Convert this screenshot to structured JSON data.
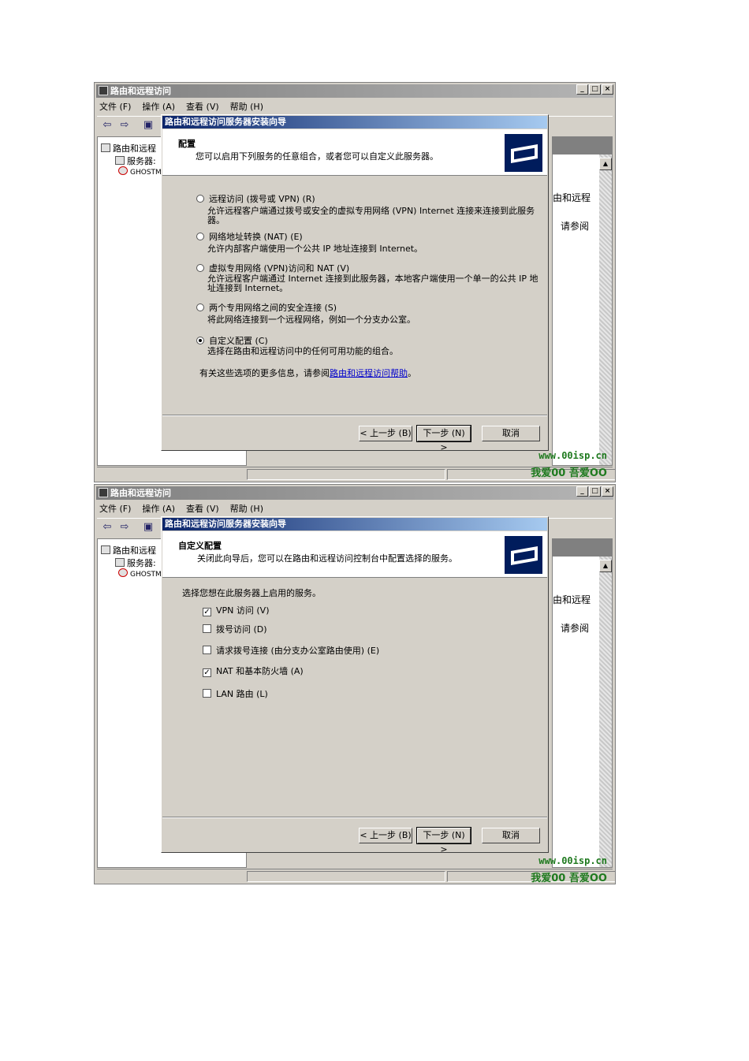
{
  "panels": [
    {
      "window_title": "路由和远程访问",
      "menu": [
        "文件 (F)",
        "操作 (A)",
        "查看 (V)",
        "帮助 (H)"
      ],
      "tree": [
        "路由和远程",
        "服务器:",
        "GHOSTM/"
      ],
      "right_text": [
        "由和远程",
        "请参阅"
      ],
      "watermark_url": "www.00isp.cn",
      "watermark_text": "我爱00 吾爱OO",
      "wizard": {
        "title": "路由和远程访问服务器安装向导",
        "heading": "配置",
        "subheading": "您可以启用下列服务的任意组合，或者您可以自定义此服务器。",
        "options": [
          {
            "label": "远程访问 (拨号或 VPN) (R)",
            "desc": "允许远程客户端通过拨号或安全的虚拟专用网络 (VPN) Internet 连接来连接到此服务器。",
            "selected": false
          },
          {
            "label": "网络地址转换 (NAT) (E)",
            "desc": "允许内部客户端使用一个公共 IP 地址连接到 Internet。",
            "selected": false
          },
          {
            "label": "虚拟专用网络 (VPN)访问和 NAT (V)",
            "desc": "允许远程客户端通过 Internet 连接到此服务器，本地客户端使用一个单一的公共 IP 地址连接到 Internet。",
            "selected": false
          },
          {
            "label": "两个专用网络之间的安全连接 (S)",
            "desc": "将此网络连接到一个远程网络，例如一个分支办公室。",
            "selected": false
          },
          {
            "label": "自定义配置 (C)",
            "desc": "选择在路由和远程访问中的任何可用功能的组合。",
            "selected": true
          }
        ],
        "help_prefix": "有关这些选项的更多信息，请参阅",
        "help_link": "路由和远程访问帮助",
        "help_suffix": "。",
        "back": "< 上一步 (B)",
        "next": "下一步 (N) >",
        "cancel": "取消"
      }
    },
    {
      "window_title": "路由和远程访问",
      "menu": [
        "文件 (F)",
        "操作 (A)",
        "查看 (V)",
        "帮助 (H)"
      ],
      "tree": [
        "路由和远程",
        "服务器:",
        "GHOSTM/"
      ],
      "right_text": [
        "由和远程",
        "请参阅"
      ],
      "watermark_url": "www.00isp.cn",
      "watermark_text": "我爱00 吾爱OO",
      "wizard": {
        "title": "路由和远程访问服务器安装向导",
        "heading": "自定义配置",
        "subheading": "关闭此向导后，您可以在路由和远程访问控制台中配置选择的服务。",
        "prompt": "选择您想在此服务器上启用的服务。",
        "services": [
          {
            "label": "VPN 访问 (V)",
            "checked": true
          },
          {
            "label": "拨号访问 (D)",
            "checked": false
          },
          {
            "label": "请求拨号连接 (由分支办公室路由使用) (E)",
            "checked": false
          },
          {
            "label": "NAT 和基本防火墙 (A)",
            "checked": true
          },
          {
            "label": "LAN 路由 (L)",
            "checked": false
          }
        ],
        "back": "< 上一步 (B)",
        "next": "下一步 (N) >",
        "cancel": "取消"
      }
    }
  ]
}
